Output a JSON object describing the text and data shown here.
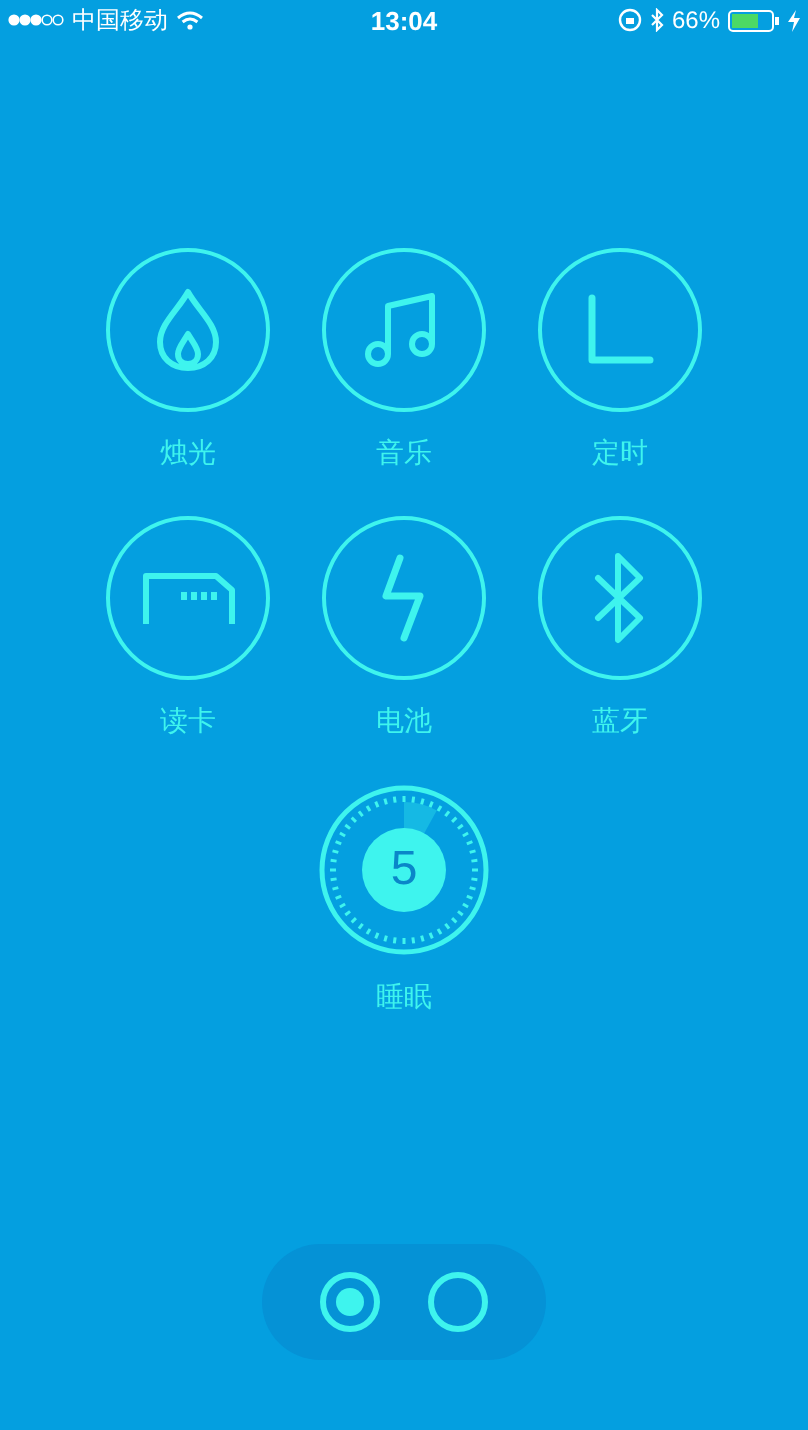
{
  "status_bar": {
    "carrier": "中国移动",
    "time": "13:04",
    "battery": "66%"
  },
  "features": [
    {
      "kind": "flame",
      "label": "烛光"
    },
    {
      "kind": "music",
      "label": "音乐"
    },
    {
      "kind": "clock",
      "label": "定时"
    },
    {
      "kind": "card",
      "label": "读卡"
    },
    {
      "kind": "bolt",
      "label": "电池"
    },
    {
      "kind": "bluetooth",
      "label": "蓝牙"
    }
  ],
  "sleep": {
    "label": "睡眠",
    "value": "5"
  },
  "pages": [
    {
      "selected": true
    },
    {
      "selected": false
    }
  ]
}
